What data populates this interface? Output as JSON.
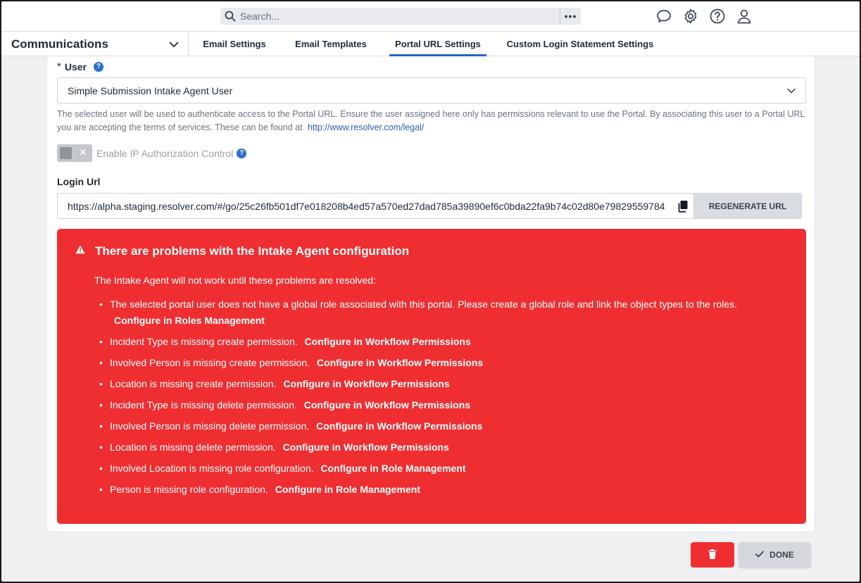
{
  "search": {
    "placeholder": "Search...",
    "more_label": "•••"
  },
  "header_icons": [
    "chat-icon",
    "settings-icon",
    "help-icon",
    "user-icon"
  ],
  "nav": {
    "section_title": "Communications",
    "tabs": [
      {
        "label": "Email Settings",
        "active": false
      },
      {
        "label": "Email Templates",
        "active": false
      },
      {
        "label": "Portal URL Settings",
        "active": true
      },
      {
        "label": "Custom Login Statement Settings",
        "active": false
      }
    ]
  },
  "form": {
    "user_label": "User",
    "required_mark": "*",
    "help_mark": "?",
    "user_value": "Simple Submission Intake Agent User",
    "user_help_text": "The selected user will be used to authenticate access to the Portal URL. Ensure the user assigned here only has permissions relevant to use the Portal. By associating this user to a Portal URL you are accepting the terms of services. These can be found at",
    "legal_link": "http://www.resolver.com/legal/",
    "ip_toggle_label": "Enable IP Authorization Control",
    "ip_toggle_on": false,
    "login_url_label": "Login Url",
    "login_url_value": "https://alpha.staging.resolver.com/#/go/25c26fb501df7e018208b4ed57a570ed27dad785a39890ef6c0bda22fa9b74c02d80e79829559784",
    "regenerate_label": "REGENERATE URL"
  },
  "error": {
    "title": "There are problems with the Intake Agent configuration",
    "intro": "The Intake Agent will not work until these problems are resolved:",
    "items": [
      {
        "text": "The selected portal user does not have a global role associated with this portal. Please create a global role and link the object types to the roles.",
        "link": "Configure in Roles Management"
      },
      {
        "text": "Incident Type is missing create permission.",
        "link": "Configure in Workflow Permissions"
      },
      {
        "text": "Involved Person is missing create permission.",
        "link": "Configure in Workflow Permissions"
      },
      {
        "text": "Location is missing create permission.",
        "link": "Configure in Workflow Permissions"
      },
      {
        "text": "Incident Type is missing delete permission.",
        "link": "Configure in Workflow Permissions"
      },
      {
        "text": "Involved Person is missing delete permission.",
        "link": "Configure in Workflow Permissions"
      },
      {
        "text": "Location is missing delete permission.",
        "link": "Configure in Workflow Permissions"
      },
      {
        "text": "Involved Location is missing role configuration.",
        "link": "Configure in Role Management"
      },
      {
        "text": "Person is missing role configuration.",
        "link": "Configure in Role Management"
      }
    ]
  },
  "footer": {
    "done_label": "DONE"
  },
  "colors": {
    "accent": "#2563c9",
    "error": "#ef2e32",
    "link": "#2a5fb8"
  }
}
